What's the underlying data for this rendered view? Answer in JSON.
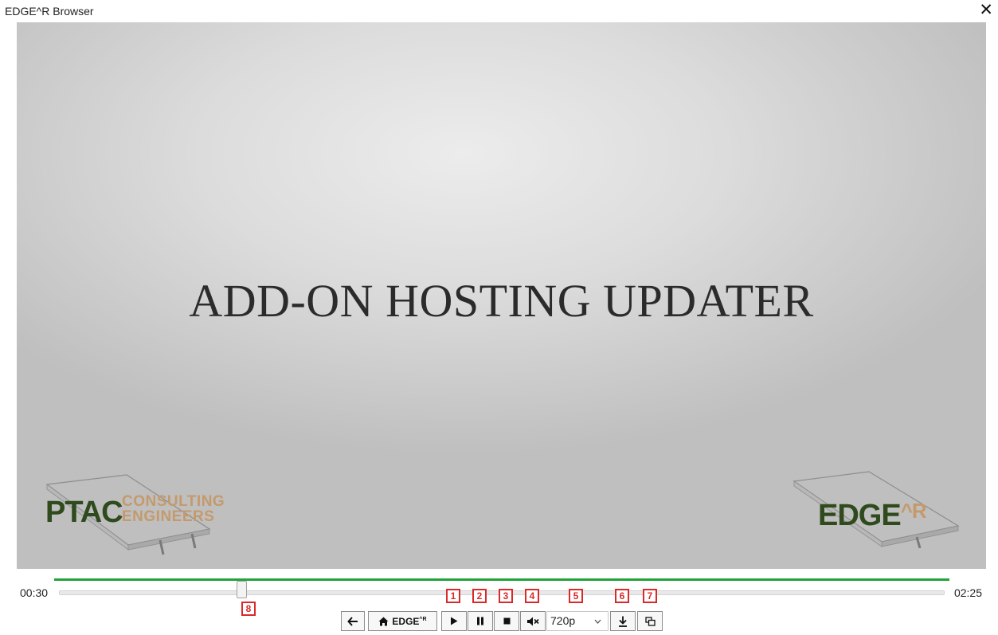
{
  "window": {
    "title": "EDGE^R Browser",
    "close_glyph": "✕"
  },
  "video": {
    "headline": "ADD-ON HOSTING UPDATER",
    "logo_left": {
      "main": "PTAC",
      "line1": "CONSULTING",
      "line2": "ENGINEERS"
    },
    "logo_right": {
      "main": "EDGE",
      "sup": "^R"
    }
  },
  "player": {
    "current_time": "00:30",
    "total_time": "02:25",
    "progress_fraction": 0.207,
    "quality": {
      "selected": "720p"
    },
    "home_label": "EDGE",
    "home_sup": "^R"
  },
  "markers": [
    "1",
    "2",
    "3",
    "4",
    "5",
    "6",
    "7",
    "8"
  ],
  "icons": {
    "back": "arrow-left-icon",
    "home": "home-icon",
    "play": "play-icon",
    "pause": "pause-icon",
    "stop": "stop-icon",
    "mute": "mute-icon",
    "download": "download-icon",
    "popout": "popout-icon",
    "dropdown": "chevron-down-icon"
  },
  "colors": {
    "progress": "#22a33a",
    "marker": "#d92a2a",
    "logo_green": "#2f4a1c",
    "logo_tan": "#c49a6c"
  }
}
